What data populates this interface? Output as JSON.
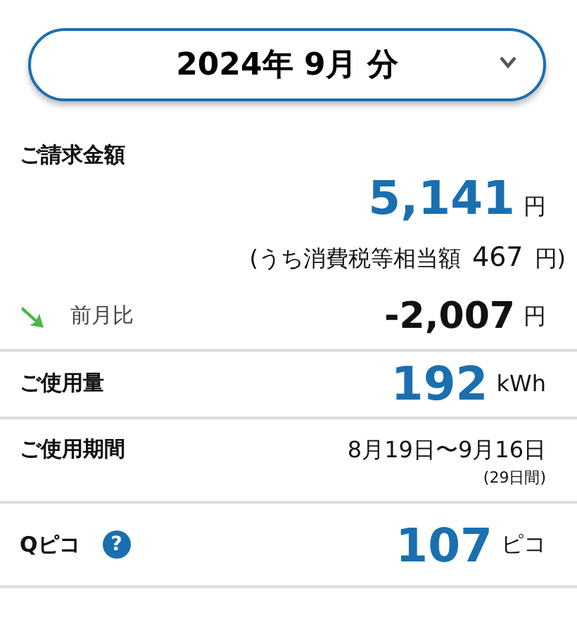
{
  "month_selector": {
    "label": "2024年 9月 分",
    "expanded": false
  },
  "billing": {
    "label": "ご請求金額",
    "amount": "5,141",
    "unit": "円",
    "tax_prefix": "(うち消費税等相当額",
    "tax_amount": "467",
    "tax_suffix": "円)"
  },
  "comparison": {
    "label": "前月比",
    "decreased": true,
    "amount": "-2,007",
    "unit": "円"
  },
  "usage": {
    "label": "ご使用量",
    "amount": "192",
    "unit": "kWh"
  },
  "period": {
    "label": "ご使用期間",
    "range": "8月19日〜9月16日",
    "days": "(29日間)"
  },
  "points": {
    "label": "Qピコ",
    "help": "?",
    "amount": "107",
    "unit": "ピコ"
  }
}
